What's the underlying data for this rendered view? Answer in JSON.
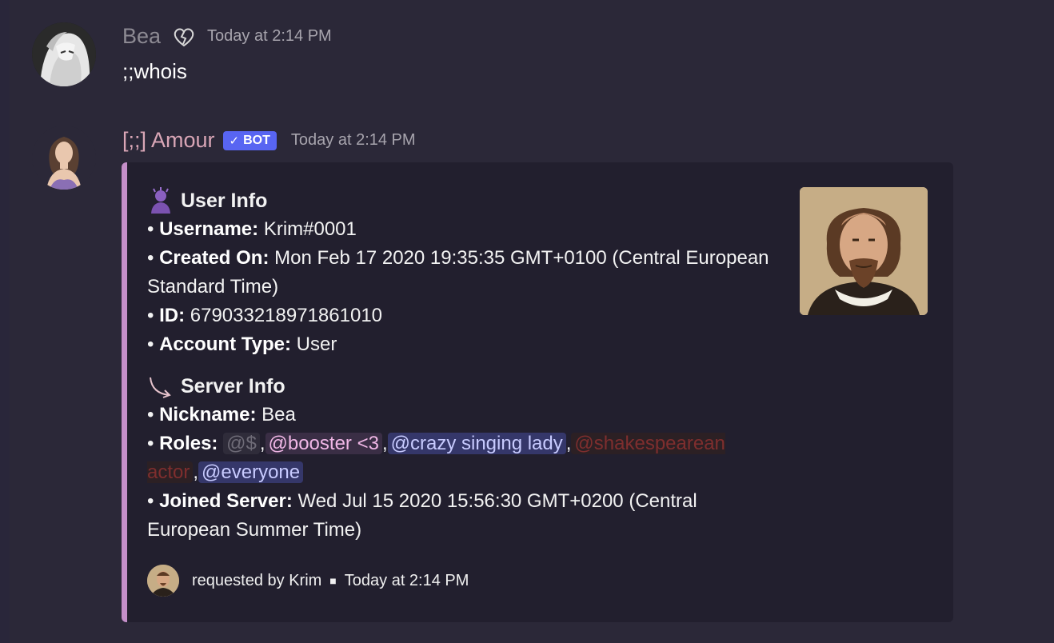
{
  "messages": [
    {
      "author": "Bea",
      "timestamp": "Today at 2:14 PM",
      "text": ";;whois"
    },
    {
      "author": "[;;] Amour",
      "bot_tag": "BOT",
      "timestamp": "Today at 2:14 PM"
    }
  ],
  "embed": {
    "user_info_title": "User Info",
    "username_label": "Username:",
    "username_value": "Krim#0001",
    "created_label": "Created On:",
    "created_value": "Mon Feb 17 2020 19:35:35 GMT+0100 (Central European Standard Time)",
    "id_label": "ID:",
    "id_value": "679033218971861010",
    "account_label": "Account Type:",
    "account_value": "User",
    "server_info_title": "Server Info",
    "nickname_label": "Nickname:",
    "nickname_value": "Bea",
    "roles_label": "Roles:",
    "roles": [
      "@$",
      "@booster <3",
      "@crazy singing lady",
      "@shakespearean actor",
      "@everyone"
    ],
    "joined_label": "Joined Server:",
    "joined_value": "Wed Jul 15 2020 15:56:30 GMT+0200 (Central European Summer Time)",
    "footer_text": "requested by Krim",
    "footer_timestamp": "Today at 2:14 PM",
    "accent_color": "#c58fc9"
  },
  "bullet": "•",
  "separator": ","
}
